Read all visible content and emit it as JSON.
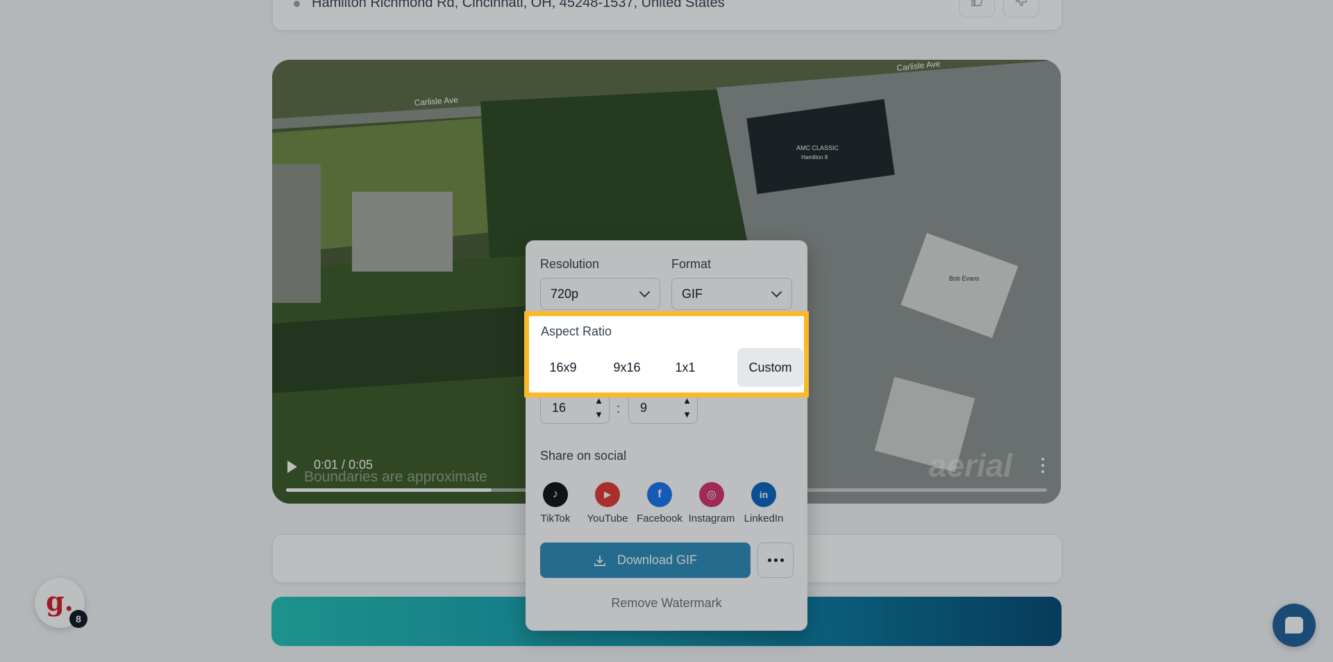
{
  "address_card": {
    "text": "Hamilton Richmond Rd, Cincinnati, OH, 45248-1537, United States"
  },
  "video": {
    "time": "0:01 / 0:05",
    "progress": 0.27,
    "caption": "Boundaries are approximate",
    "watermark": "aerial",
    "map_labels": {
      "street_1": "Carlisle Ave",
      "street_2": "Carlisle Ave",
      "building_1": "AMC CLASSIC",
      "building_1_sub": "Hamilton 8",
      "building_2": "Bob Evans"
    }
  },
  "export_panel": {
    "resolution_label": "Resolution",
    "resolution_value": "720p",
    "format_label": "Format",
    "format_value": "GIF",
    "aspect_ratio_label": "Aspect Ratio",
    "aspect_options": [
      "16x9",
      "9x16",
      "1x1",
      "Custom"
    ],
    "selected_aspect": "Custom",
    "custom_width": "16",
    "custom_height": "9",
    "ratio_separator": ":",
    "share_label": "Share on social",
    "social": [
      {
        "name": "TikTok",
        "color": "#111111",
        "glyph": "♪"
      },
      {
        "name": "YouTube",
        "color": "#e53935",
        "glyph": "▶"
      },
      {
        "name": "Facebook",
        "color": "#1877f2",
        "glyph": "f"
      },
      {
        "name": "Instagram",
        "color": "#d6336c",
        "glyph": "◎"
      },
      {
        "name": "LinkedIn",
        "color": "#0a66c2",
        "glyph": "in"
      }
    ],
    "download_label": "Download GIF",
    "remove_watermark_label": "Remove Watermark"
  },
  "avatar": {
    "letter": "g.",
    "badge": "8"
  },
  "colors": {
    "highlight": "#fbb829",
    "download_button": "#2f8cbb",
    "accent_gradient_start": "#22c3b8",
    "accent_gradient_end": "#054a75"
  }
}
